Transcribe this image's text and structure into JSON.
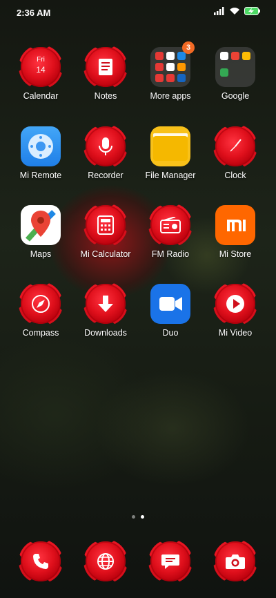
{
  "status_bar": {
    "time": "2:36 AM"
  },
  "calendar": {
    "day": "Fri",
    "date": "14"
  },
  "folder_badge": "3",
  "apps": [
    {
      "label": "Calendar"
    },
    {
      "label": "Notes"
    },
    {
      "label": "More apps"
    },
    {
      "label": "Google"
    },
    {
      "label": "Mi Remote"
    },
    {
      "label": "Recorder"
    },
    {
      "label": "File Manager"
    },
    {
      "label": "Clock"
    },
    {
      "label": "Maps"
    },
    {
      "label": "Mi Calculator"
    },
    {
      "label": "FM Radio"
    },
    {
      "label": "Mi Store"
    },
    {
      "label": "Compass"
    },
    {
      "label": "Downloads"
    },
    {
      "label": "Duo"
    },
    {
      "label": "Mi Video"
    }
  ],
  "page_indicator": {
    "pages": 2,
    "current": 2
  },
  "colors": {
    "rose_red": "#e0101c",
    "mi_orange": "#ff6700",
    "duo_blue": "#1a73e8",
    "folder_yellow": "#f8c11a",
    "remote_blue": "#2e8ef0"
  }
}
